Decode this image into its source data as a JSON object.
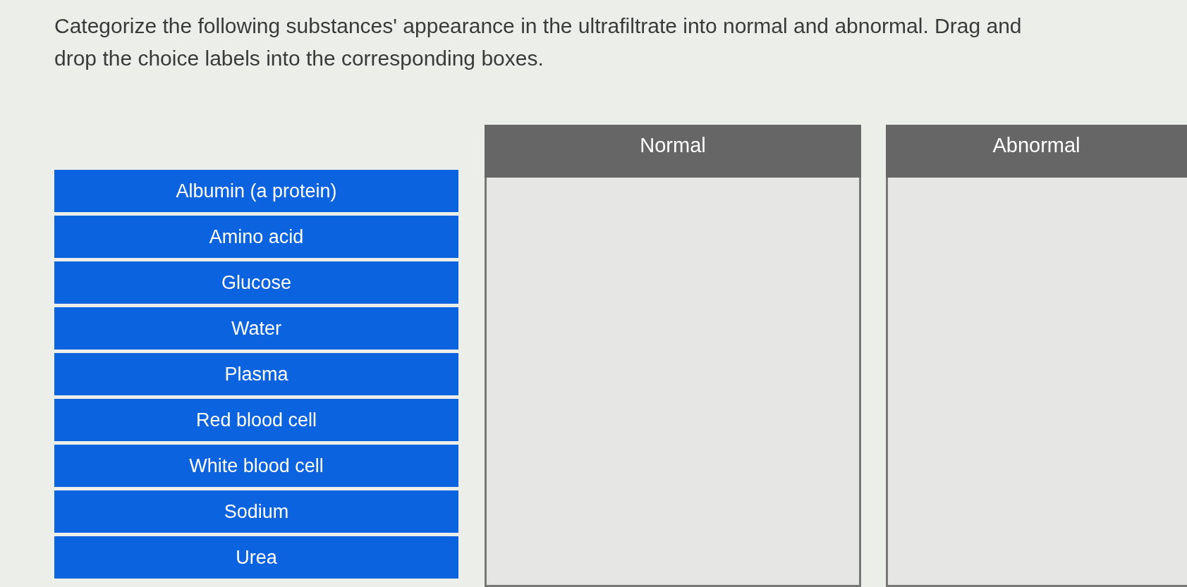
{
  "instruction": "Categorize the following substances' appearance in the ultrafiltrate into normal and abnormal. Drag and drop the choice labels into the corresponding boxes.",
  "choices": [
    "Albumin (a protein)",
    "Amino acid",
    "Glucose",
    "Water",
    "Plasma",
    "Red blood cell",
    "White blood cell",
    "Sodium",
    "Urea"
  ],
  "categories": [
    {
      "title": "Normal"
    },
    {
      "title": "Abnormal"
    }
  ]
}
